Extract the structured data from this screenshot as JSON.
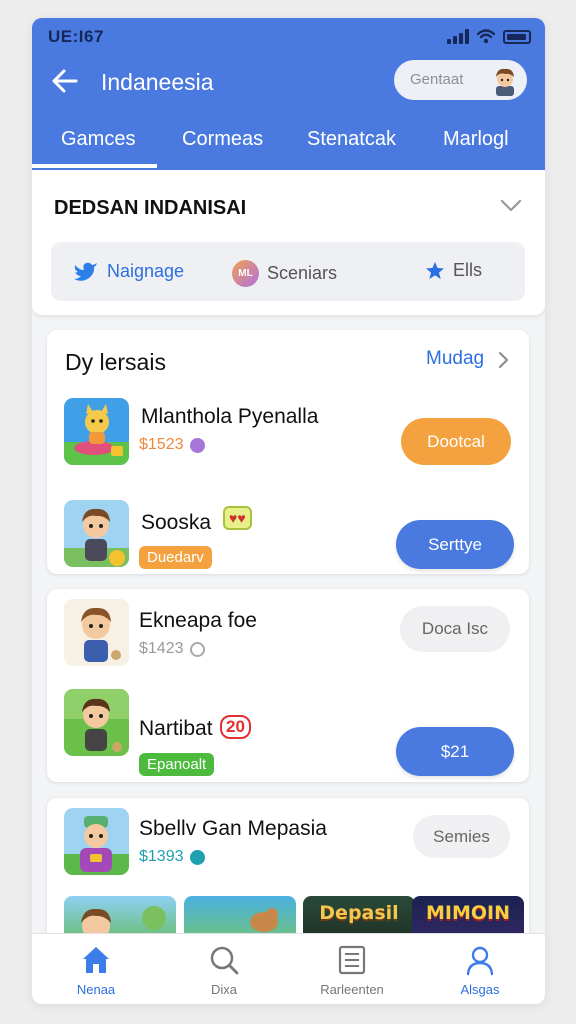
{
  "status": {
    "time": "UE:I67"
  },
  "header": {
    "title": "Indaneesia",
    "account_label": "Gentaat"
  },
  "tabs": [
    {
      "label": "Gamces",
      "active": true
    },
    {
      "label": "Cormeas",
      "active": false
    },
    {
      "label": "Stenatcak",
      "active": false
    },
    {
      "label": "Marlogl",
      "active": false
    }
  ],
  "filter": {
    "title": "DEDSAN INDANISAI",
    "chips": [
      {
        "label": "Naignage",
        "icon": "bird-icon",
        "color": "#2c6fe0"
      },
      {
        "label": "Sceniars",
        "icon": "ml-badge-icon",
        "badge_text": "ML"
      },
      {
        "label": "Ells",
        "icon": "star-icon"
      }
    ]
  },
  "section": {
    "title": "Dy lersais",
    "link": "Mudag"
  },
  "items": [
    {
      "name": "Mlanthola Pyenalla",
      "price": "$1523",
      "price_color": "#f0883a",
      "action": "Dootcal",
      "action_style": "orange"
    },
    {
      "name": "Sooska",
      "tag": "Duedarv",
      "tag_color": "#f4a240",
      "action": "Serttye",
      "action_style": "blue"
    },
    {
      "name": "Ekneapa foe",
      "price": "$1423",
      "price_color": "#9a9a9a",
      "action": "Doca Isc",
      "action_style": "grey"
    },
    {
      "name": "Nartibat",
      "name_badge": "20",
      "tag": "Epanoalt",
      "tag_color": "#4cba3c",
      "action": "$21",
      "action_style": "blue"
    },
    {
      "name": "Sbellv Gan Mepasia",
      "price": "$1393",
      "price_color": "#1ea0b0",
      "action": "Semies",
      "action_style": "grey"
    }
  ],
  "tiles": [
    {
      "label": ""
    },
    {
      "label": ""
    },
    {
      "label": "Depasil"
    },
    {
      "label": "MIMOIN"
    }
  ],
  "bottom_nav": [
    {
      "label": "Nenaa",
      "icon": "home-icon",
      "active": true
    },
    {
      "label": "Dixa",
      "icon": "search-icon",
      "active": false
    },
    {
      "label": "Rarleenten",
      "icon": "document-icon",
      "active": false
    },
    {
      "label": "Alsgas",
      "icon": "profile-icon",
      "active": false
    }
  ],
  "colors": {
    "primary": "#4a7ae0",
    "accent_orange": "#f4a240",
    "accent_green": "#4cba3c",
    "link_blue": "#2c6fe0"
  }
}
